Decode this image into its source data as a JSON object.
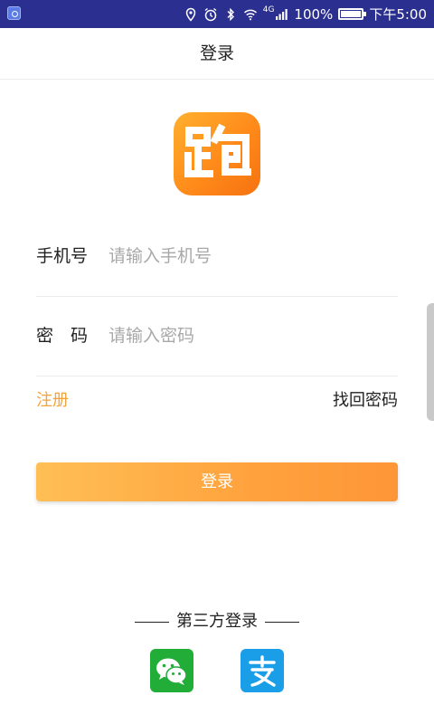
{
  "status_bar": {
    "network": "4G",
    "battery": "100%",
    "time": "下午5:00"
  },
  "header": {
    "title": "登录"
  },
  "form": {
    "phone_label": "手机号",
    "phone_placeholder": "请输入手机号",
    "password_label": "密　码",
    "password_placeholder": "请输入密码"
  },
  "links": {
    "register": "注册",
    "forgot": "找回密码"
  },
  "login_button": "登录",
  "third_party": {
    "title": "第三方登录",
    "providers": [
      "wechat",
      "alipay"
    ]
  },
  "colors": {
    "status_bar": "#2b2f8f",
    "accent": "#f3a33a",
    "wechat": "#22ac38",
    "alipay": "#1b9ee8"
  },
  "icons": [
    "app-logo-icon",
    "wechat-icon",
    "alipay-icon",
    "location-icon",
    "alarm-icon",
    "bluetooth-icon",
    "wifi-icon",
    "signal-icon",
    "battery-icon"
  ]
}
